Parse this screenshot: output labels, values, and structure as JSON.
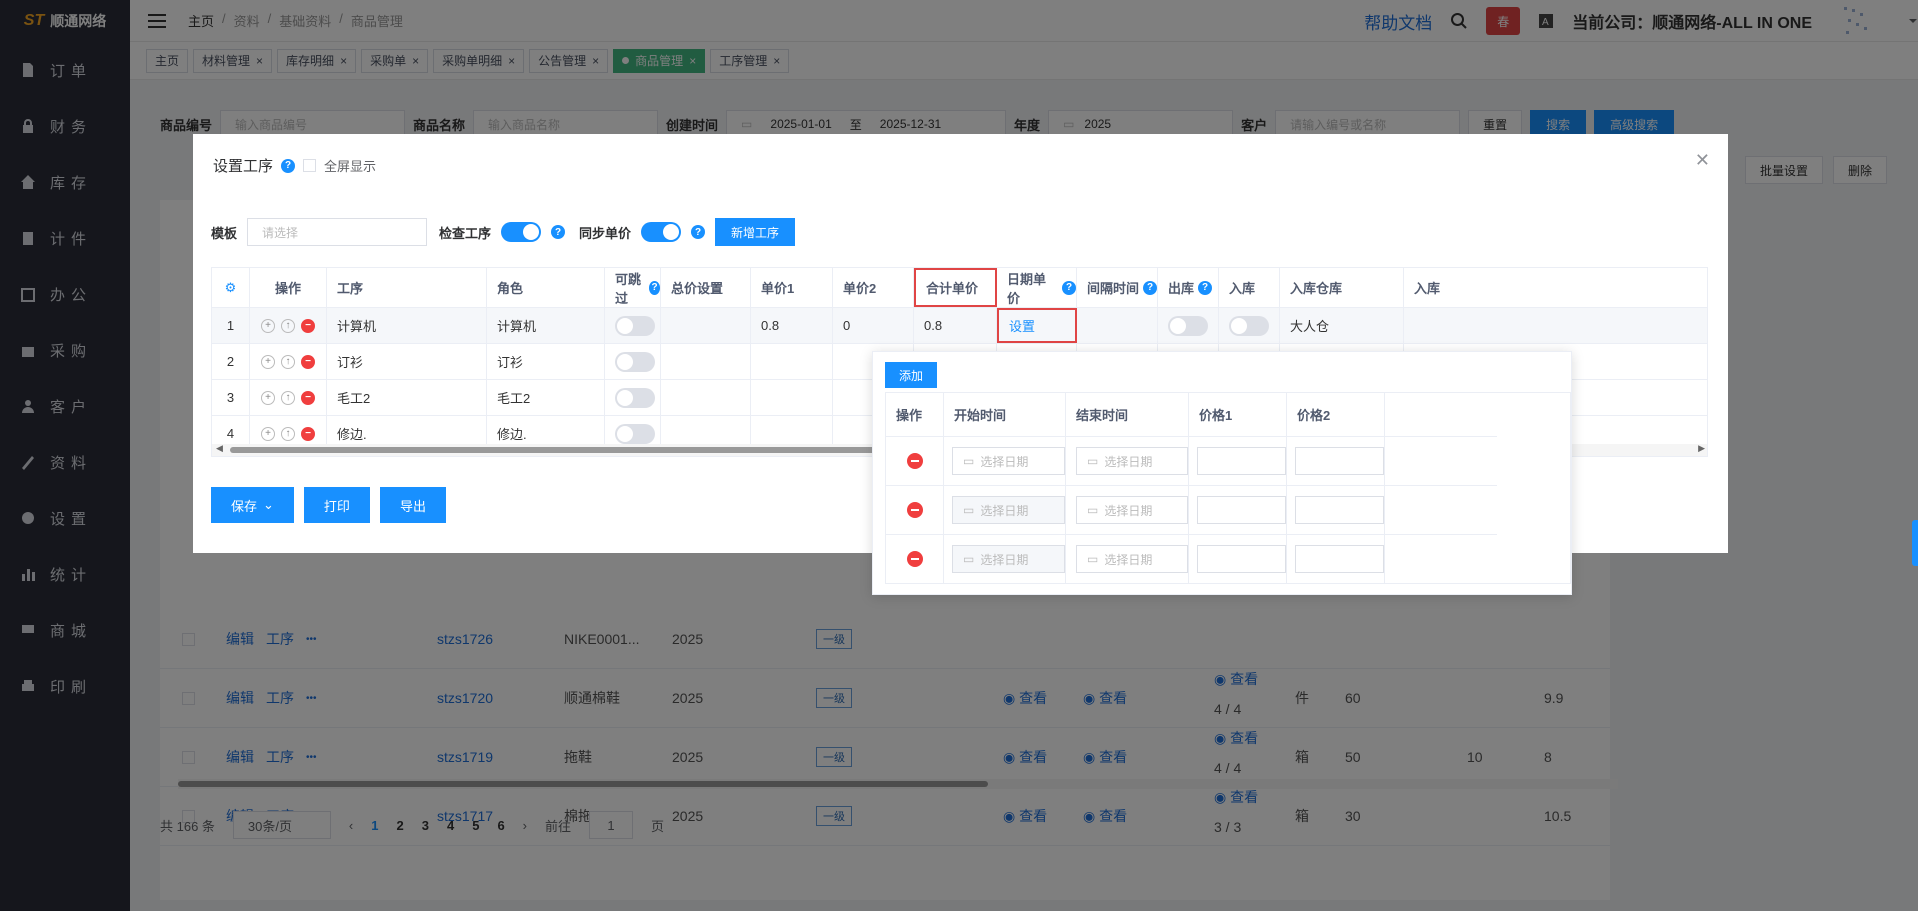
{
  "sidebar": {
    "logo": "顺通网络",
    "items": [
      {
        "label": "订单",
        "icon": "doc-icon"
      },
      {
        "label": "财务",
        "icon": "lock-icon"
      },
      {
        "label": "库存",
        "icon": "home-icon"
      },
      {
        "label": "计件",
        "icon": "clipboard-icon"
      },
      {
        "label": "办公",
        "icon": "calendar-icon"
      },
      {
        "label": "采购",
        "icon": "bag-icon"
      },
      {
        "label": "客户",
        "icon": "user-icon"
      },
      {
        "label": "资料",
        "icon": "pen-icon"
      },
      {
        "label": "设置",
        "icon": "gear-icon"
      },
      {
        "label": "统计",
        "icon": "chart-icon"
      },
      {
        "label": "商城",
        "icon": "shop-icon"
      },
      {
        "label": "印刷",
        "icon": "print-icon"
      }
    ]
  },
  "header": {
    "breadcrumb": [
      "主页",
      "资料",
      "基础资料",
      "商品管理"
    ],
    "help": "帮助文档",
    "company": "当前公司：顺通网络-ALL IN ONE",
    "badge": "春"
  },
  "tabs": [
    {
      "label": "主页"
    },
    {
      "label": "材料管理"
    },
    {
      "label": "库存明细"
    },
    {
      "label": "采购单"
    },
    {
      "label": "采购单明细"
    },
    {
      "label": "公告管理"
    },
    {
      "label": "商品管理",
      "active": true
    },
    {
      "label": "工序管理"
    }
  ],
  "filter": {
    "code_label": "商品编号",
    "code_ph": "输入商品编号",
    "name_label": "商品名称",
    "name_ph": "输入商品名称",
    "created_label": "创建时间",
    "date_from": "2025-01-01",
    "date_to_sep": "至",
    "date_to": "2025-12-31",
    "year_label": "年度",
    "year": "2025",
    "customer_label": "客户",
    "customer_ph": "请输入编号或名称",
    "reset": "重置",
    "search": "搜索",
    "advanced": "高级搜索",
    "batch": "批量设置",
    "delete": "删除"
  },
  "bg_rows": [
    {
      "edit": "编辑",
      "proc": "工序",
      "more": "•••",
      "code": "stzs1726",
      "name": "NIKE0001...",
      "year": "2025",
      "level": "一级",
      "view1": "",
      "view2": "",
      "view3": "",
      "ratio": "",
      "unit": "",
      "qty": "",
      "v2": "",
      "price": ""
    },
    {
      "edit": "编辑",
      "proc": "工序",
      "more": "•••",
      "code": "stzs1720",
      "name": "顺通棉鞋",
      "year": "2025",
      "level": "一级",
      "view1": "查看",
      "view2": "查看",
      "view3": "查看",
      "ratio": "4 / 4",
      "unit": "件",
      "qty": "60",
      "v2": "",
      "price": "9.9"
    },
    {
      "edit": "编辑",
      "proc": "工序",
      "more": "•••",
      "code": "stzs1719",
      "name": "拖鞋",
      "year": "2025",
      "level": "一级",
      "view1": "查看",
      "view2": "查看",
      "view3": "查看",
      "ratio": "4 / 4",
      "unit": "箱",
      "qty": "50",
      "v2": "10",
      "price": "8"
    },
    {
      "edit": "编辑",
      "proc": "工序",
      "more": "•••",
      "code": "stzs1717",
      "name": "棉拖2025",
      "year": "2025",
      "level": "一级",
      "view1": "查看",
      "view2": "查看",
      "view3": "查看",
      "ratio": "3 / 3",
      "unit": "箱",
      "qty": "30",
      "v2": "",
      "price": "10.5"
    }
  ],
  "pager": {
    "total": "共 166 条",
    "size": "30条/页",
    "pages": [
      "1",
      "2",
      "3",
      "4",
      "5",
      "6"
    ],
    "goto": "前往",
    "goto_val": "1",
    "page_unit": "页"
  },
  "dialog": {
    "title": "设置工序",
    "fullscreen": "全屏显示",
    "template_label": "模板",
    "template_ph": "请选择",
    "check_label": "检查工序",
    "sync_label": "同步单价",
    "new_btn": "新增工序",
    "columns": [
      "操作",
      "工序",
      "角色",
      "可跳过",
      "总价设置",
      "单价1",
      "单价2",
      "合计单价",
      "日期单价",
      "间隔时间",
      "出库",
      "入库",
      "入库仓库",
      "入库"
    ],
    "rows": [
      {
        "idx": "1",
        "proc": "计算机",
        "role": "计算机",
        "p1": "0.8",
        "p2": "0",
        "total": "0.8",
        "date_price": "设置",
        "warehouse": "大人仓"
      },
      {
        "idx": "2",
        "proc": "订衫",
        "role": "订衫"
      },
      {
        "idx": "3",
        "proc": "毛工2",
        "role": "毛工2"
      },
      {
        "idx": "4",
        "proc": "修边.",
        "role": "修边."
      }
    ],
    "save": "保存",
    "print": "打印",
    "export": "导出"
  },
  "popover": {
    "add": "添加",
    "columns": [
      "操作",
      "开始时间",
      "结束时间",
      "价格1",
      "价格2"
    ],
    "date_ph": "选择日期"
  }
}
